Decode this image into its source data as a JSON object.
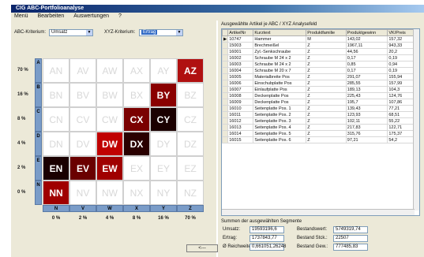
{
  "window": {
    "title": "CIG ABC-Portfolioanalyse"
  },
  "menu": {
    "items": [
      "Menü",
      "Bearbeiten",
      "Auswertungen",
      "?"
    ]
  },
  "filters": {
    "abc_label": "ABC-Kriterium:",
    "abc_value": "Umsatz",
    "xyz_label": "XYZ-Kriterium:",
    "xyz_value": "Ertrag"
  },
  "matrix": {
    "row_headers": [
      "A",
      "B",
      "C",
      "D",
      "E",
      "N"
    ],
    "row_percent_labels": [
      "70 %",
      "16 %",
      "8 %",
      "4 %",
      "2 %",
      "0 %"
    ],
    "col_headers": [
      "N",
      "V",
      "W",
      "X",
      "Y",
      "Z"
    ],
    "col_percent_labels": [
      "0 %",
      "2 %",
      "4 %",
      "8 %",
      "16 %",
      "70 %"
    ],
    "cells": [
      [
        "AN",
        "AV",
        "AW",
        "AX",
        "AY",
        "AZ"
      ],
      [
        "BN",
        "BV",
        "BW",
        "BX",
        "BY",
        "BZ"
      ],
      [
        "CN",
        "CV",
        "CW",
        "CX",
        "CY",
        "CZ"
      ],
      [
        "DN",
        "DV",
        "DW",
        "DX",
        "DY",
        "DZ"
      ],
      [
        "EN",
        "EV",
        "EW",
        "EX",
        "EY",
        "EZ"
      ],
      [
        "NN",
        "NV",
        "NW",
        "NX",
        "NY",
        "NZ"
      ]
    ],
    "cell_colors": [
      [
        "#ffffff",
        "#ffffff",
        "#ffffff",
        "#ffffff",
        "#ffffff",
        "#b01010"
      ],
      [
        "#ffffff",
        "#ffffff",
        "#ffffff",
        "#ffffff",
        "#8a0000",
        "#ffffff"
      ],
      [
        "#ffffff",
        "#ffffff",
        "#ffffff",
        "#7a0000",
        "#1a0000",
        "#ffffff"
      ],
      [
        "#ffffff",
        "#ffffff",
        "#c00000",
        "#2a0000",
        "#ffffff",
        "#ffffff"
      ],
      [
        "#1a0000",
        "#6a0000",
        "#a00000",
        "#ffffff",
        "#ffffff",
        "#ffffff"
      ],
      [
        "#a00000",
        "#ffffff",
        "#ffffff",
        "#ffffff",
        "#ffffff",
        "#ffffff"
      ]
    ],
    "reset_label": "<---"
  },
  "list": {
    "title": "Ausgewählte Artikel je ABC / XYZ Analysefeld",
    "columns": [
      "ArtikelNr",
      "Kurztext",
      "Produktfamilie",
      "Produktgewinn",
      "VK/Preis"
    ],
    "rows": [
      [
        "10747",
        "Hammer",
        "M",
        "143,02",
        "157,32"
      ],
      [
        "15003",
        "Brechmeißel",
        "Z",
        "1967,11",
        "943,33"
      ],
      [
        "16001",
        "Zyl.-Senkschraube",
        "Z",
        "44,56",
        "20,2"
      ],
      [
        "16002",
        "Schraube M 24 x 2",
        "Z",
        "0,17",
        "0,19"
      ],
      [
        "16003",
        "Schraube M 24 x 2",
        "Z",
        "0,85",
        "0,94"
      ],
      [
        "16004",
        "Schraube M 20 x 7",
        "Z",
        "0,17",
        "0,19"
      ],
      [
        "16005",
        "Materialbreite Pos",
        "Z",
        "291,07",
        "155,94"
      ],
      [
        "16006",
        "Einschubplatte Pos",
        "Z",
        "285,55",
        "157,99"
      ],
      [
        "16007",
        "Einlaufplatte Pos",
        "Z",
        "189,13",
        "104,3"
      ],
      [
        "16008",
        "Deckenplatte Pos",
        "Z",
        "225,43",
        "124,76"
      ],
      [
        "16009",
        "Deckenplatte Pos",
        "Z",
        "195,7",
        "107,86"
      ],
      [
        "16010",
        "Seitenplatte Pos. 1",
        "Z",
        "139,43",
        "77,21"
      ],
      [
        "16011",
        "Seitenplatte Pos. 2",
        "Z",
        "123,93",
        "68,51"
      ],
      [
        "16012",
        "Seitenplatte Pos. 3",
        "Z",
        "102,11",
        "55,22"
      ],
      [
        "16013",
        "Seitenplatte Pos. 4",
        "Z",
        "217,83",
        "122,71"
      ],
      [
        "16014",
        "Seitenplatte Pos. 5",
        "Z",
        "315,76",
        "175,37"
      ],
      [
        "16015",
        "Seitenplatte Pos. 6",
        "Z",
        "97,21",
        "54,2"
      ]
    ]
  },
  "summary": {
    "title": "Summen der ausgewählten Segmente",
    "umsatz_label": "Umsatz:",
    "umsatz_value": "19593196,6",
    "ertrag_label": "Ertrag:",
    "ertrag_value": "1737843,77",
    "reichweite_label": "Ø Reichweite:",
    "reichweite_value": "0,661051,26248",
    "bestandswert_label": "Bestandswert:",
    "bestandswert_value": "5749319,74",
    "bestand_stk_label": "Bestand Stck.:",
    "bestand_stk_value": "22507",
    "bestand_gew_label": "Bestand Gew.:",
    "bestand_gew_value": "777485,83"
  }
}
